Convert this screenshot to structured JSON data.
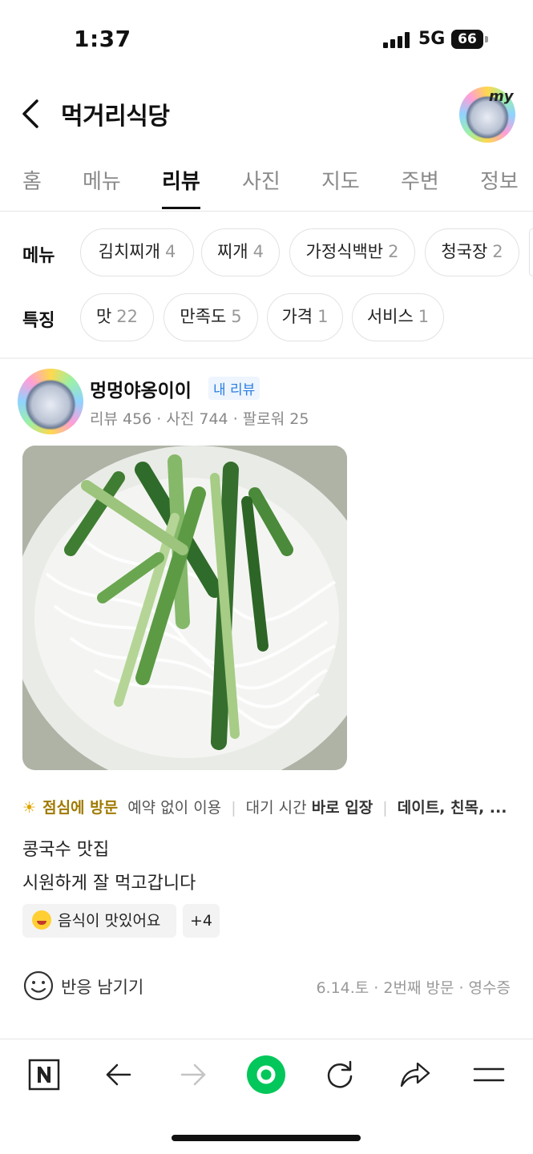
{
  "status_bar": {
    "time": "1:37",
    "network": "5G",
    "battery": "66"
  },
  "header": {
    "title": "먹거리식당",
    "avatar_badge": "my"
  },
  "tabs": [
    {
      "label": "홈"
    },
    {
      "label": "메뉴"
    },
    {
      "label": "리뷰"
    },
    {
      "label": "사진"
    },
    {
      "label": "지도"
    },
    {
      "label": "주변"
    },
    {
      "label": "정보"
    }
  ],
  "active_tab": "리뷰",
  "menu_filter": {
    "label": "메뉴",
    "chips": [
      {
        "name": "김치찌개",
        "count": "4"
      },
      {
        "name": "찌개",
        "count": "4"
      },
      {
        "name": "가정식백반",
        "count": "2"
      },
      {
        "name": "청국장",
        "count": "2"
      }
    ]
  },
  "feature_filter": {
    "label": "특징",
    "chips": [
      {
        "name": "맛",
        "count": "22"
      },
      {
        "name": "만족도",
        "count": "5"
      },
      {
        "name": "가격",
        "count": "1"
      },
      {
        "name": "서비스",
        "count": "1"
      }
    ]
  },
  "review": {
    "author": "멍멍야옹이이",
    "badge": "내 리뷰",
    "stats": "리뷰 456 · 사진 744 · 팔로워 25",
    "visit": {
      "time_label": "점심에 방문",
      "reservation": "예약 없이 이용",
      "wait_label": "대기 시간",
      "wait_value": "바로 입장",
      "purpose": "데이트, 친목, ..."
    },
    "text_line1": "콩국수 맛집",
    "text_line2": "시원하게 잘 먹고갑니다",
    "tag": "음식이 맛있어요",
    "tag_more": "+4",
    "react_label": "반응 남기기",
    "meta": "6.14.토 · 2번째 방문 · 영수증"
  },
  "colors": {
    "accent_green": "#03c75a",
    "link_blue": "#2a7de1",
    "gold": "#a07a00"
  },
  "bottom_bar": {
    "icons": [
      "naver-n-icon",
      "back-arrow-icon",
      "forward-arrow-icon",
      "green-dot-icon",
      "refresh-icon",
      "share-icon",
      "menu-icon"
    ]
  }
}
